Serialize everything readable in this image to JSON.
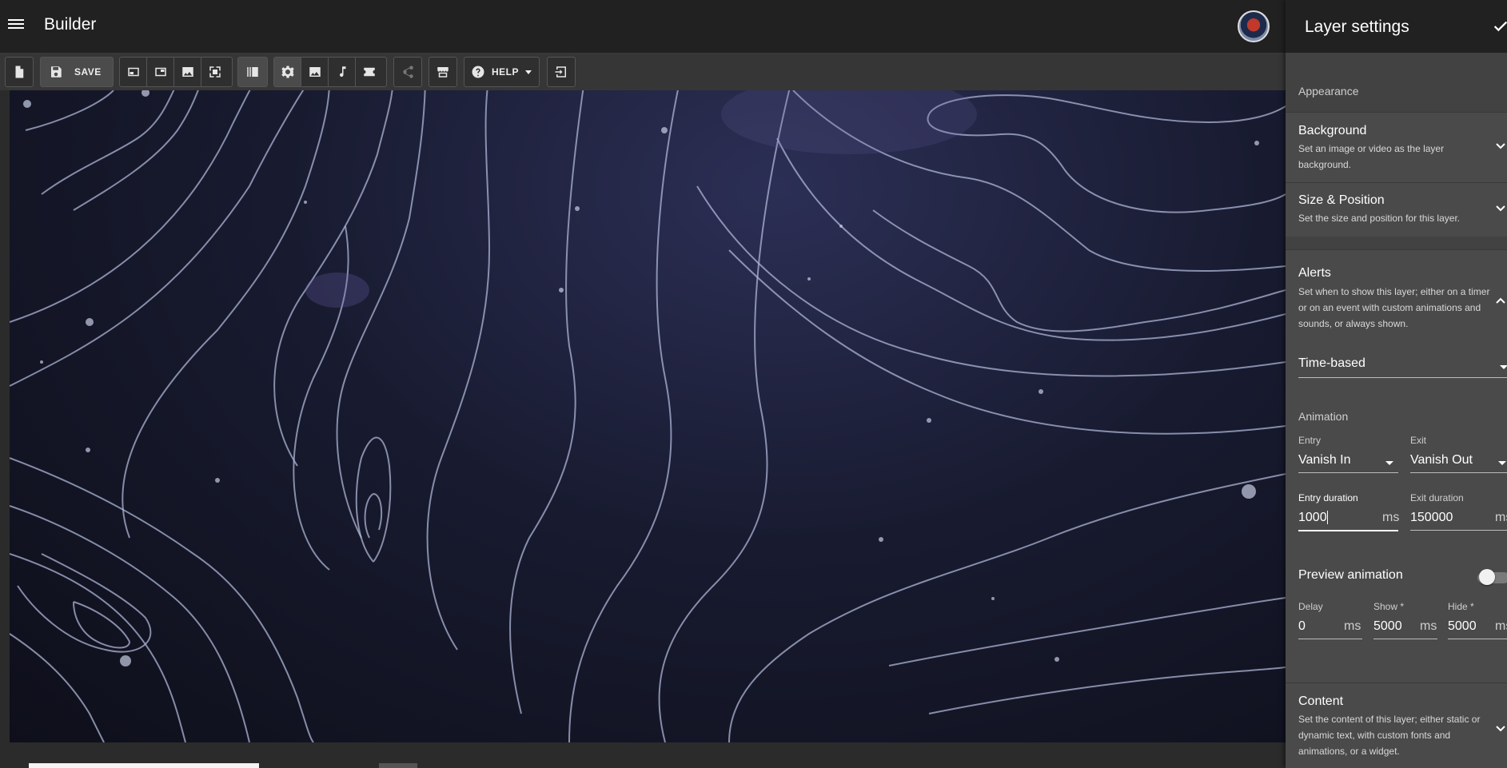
{
  "app": {
    "title": "Builder"
  },
  "toolbar": {
    "save_label": "SAVE",
    "help_label": "HELP"
  },
  "panel": {
    "title": "Layer settings",
    "appearance_label": "Appearance",
    "background": {
      "title": "Background",
      "desc": "Set an image or video as the layer background."
    },
    "size_position": {
      "title": "Size & Position",
      "desc": "Set the size and position for this layer."
    },
    "alerts": {
      "title": "Alerts",
      "desc": "Set when to show this layer; either on a timer or on an event with custom animations and sounds, or always shown.",
      "mode": "Time-based"
    },
    "animation": {
      "label": "Animation",
      "entry_label": "Entry",
      "entry_value": "Vanish In",
      "exit_label": "Exit",
      "exit_value": "Vanish Out",
      "entry_duration_label": "Entry duration",
      "entry_duration_value": "1000",
      "entry_duration_unit": "ms",
      "exit_duration_label": "Exit duration",
      "exit_duration_value": "150000",
      "exit_duration_unit": "ms"
    },
    "preview": {
      "label": "Preview animation",
      "enabled": false
    },
    "timing": {
      "delay_label": "Delay",
      "delay_value": "0",
      "delay_unit": "ms",
      "show_label": "Show *",
      "show_value": "5000",
      "show_unit": "ms",
      "hide_label": "Hide *",
      "hide_value": "5000",
      "hide_unit": "ms"
    },
    "content": {
      "title": "Content",
      "desc": "Set the content of this layer; either static or dynamic text, with custom fonts and animations, or a widget."
    }
  },
  "icons": [
    "menu-icon",
    "new-file-icon",
    "save-icon",
    "layout-icon",
    "image-icon",
    "fullscreen-icon",
    "library-icon",
    "settings-icon",
    "music-icon",
    "star-icon",
    "share-icon",
    "store-icon",
    "help-icon",
    "exit-icon",
    "check-icon"
  ],
  "colors": {
    "topbar": "#212121",
    "toolbar": "#363636",
    "panel": "#424242",
    "canvas": "#181b30"
  }
}
